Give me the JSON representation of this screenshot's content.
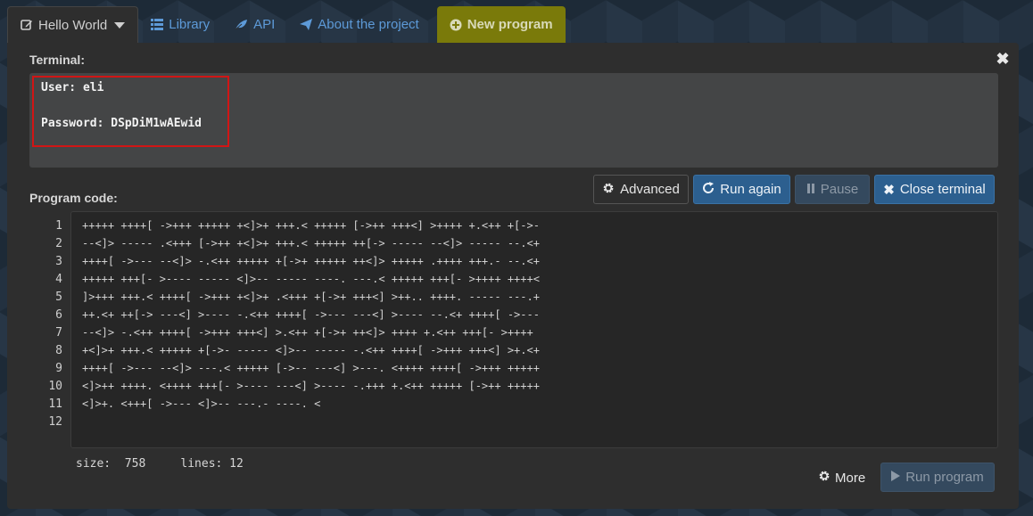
{
  "tabs": {
    "hello_world": "Hello World",
    "library": "Library",
    "api": "API",
    "about": "About the project",
    "new_program": "New program"
  },
  "terminal": {
    "label": "Terminal:",
    "user_line": "User: eli",
    "password_line": "Password: DSpDiM1wAEwid"
  },
  "program": {
    "label": "Program code:",
    "buttons": {
      "advanced": "Advanced",
      "run_again": "Run again",
      "pause": "Pause",
      "close_terminal": "Close terminal"
    },
    "line_numbers": [
      "1",
      "2",
      "3",
      "4",
      "5",
      "6",
      "7",
      "8",
      "9",
      "10",
      "11",
      "12"
    ],
    "code_lines": [
      "+++++ ++++[ ->+++ +++++ +<]>+ +++.< +++++ [->++ +++<] >++++ +.<++ +[->-",
      "--<]> ----- .<+++ [->++ +<]>+ +++.< +++++ ++[-> ----- --<]> ----- --.<+",
      "++++[ ->--- --<]> -.<++ +++++ +[->+ +++++ ++<]> +++++ .++++ +++.- --.<+",
      "+++++ +++[- >---- ----- <]>-- ----- ----. ---.< +++++ +++[- >++++ ++++<",
      "]>+++ +++.< ++++[ ->+++ +<]>+ .<+++ +[->+ +++<] >++.. ++++. ----- ---.+",
      "++.<+ ++[-> ---<] >---- -.<++ ++++[ ->--- ---<] >---- --.<+ ++++[ ->---",
      "--<]> -.<++ ++++[ ->+++ +++<] >.<++ +[->+ ++<]> ++++ +.<++ +++[- >++++",
      "+<]>+ +++.< +++++ +[->- ----- <]>-- ----- -.<++ ++++[ ->+++ +++<] >+.<+",
      "++++[ ->--- --<]> ---.< +++++ [->-- ---<] >---. <++++ ++++[ ->+++ +++++",
      "<]>++ ++++. <++++ +++[- >---- ---<] >---- -.+++ +.<++ +++++ [->++ +++++",
      "<]>+. <+++[ ->--- <]>-- ---.- ----. <",
      ""
    ],
    "stats": "size:  758     lines: 12",
    "more": "More",
    "run_program": "Run program"
  },
  "colors": {
    "new_program_tab": "#7a7a0a",
    "primary_button": "#2c5f8f",
    "highlight_border": "#d11515"
  },
  "icons": [
    "edit-icon",
    "list-icon",
    "leaf-icon",
    "send-icon",
    "plus-circle-icon",
    "close-icon",
    "gear-icon",
    "refresh-icon",
    "pause-icon",
    "times-icon",
    "play-icon"
  ]
}
